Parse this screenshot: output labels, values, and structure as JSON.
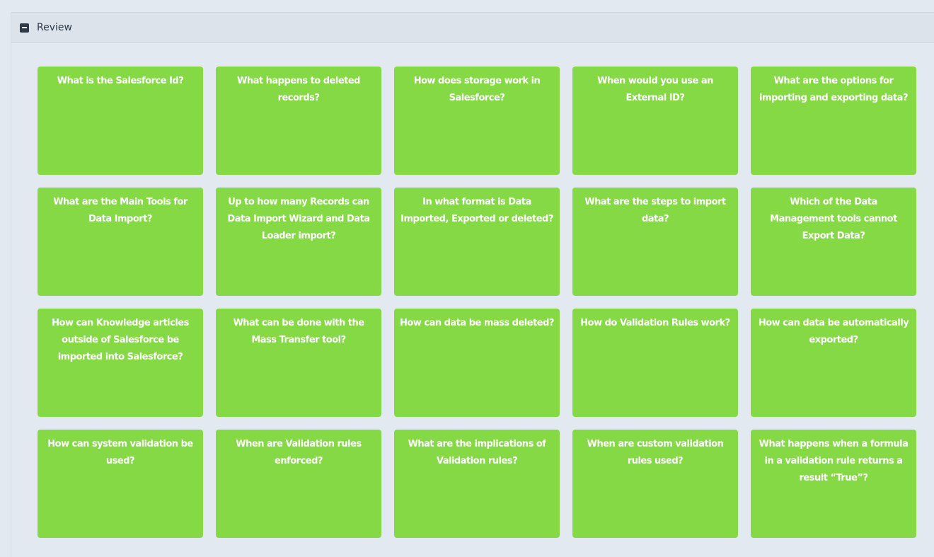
{
  "panel": {
    "title": "Review",
    "toggle_icon": "minus-square-icon"
  },
  "colors": {
    "card_background": "#84d944",
    "card_text": "#ffffff",
    "page_background": "#e3e9f1",
    "header_background": "#dde3eb"
  },
  "cards": [
    "What is the Salesforce Id?",
    "What happens to deleted records?",
    "How does storage work in Salesforce?",
    "When would you use an External ID?",
    "What are the options for importing and exporting data?",
    "What are the Main Tools for Data Import?",
    "Up to how many Records can Data Import Wizard and Data Loader import?",
    "In what format is Data Imported, Exported or deleted?",
    "What are the steps to import data?",
    "Which of the Data Management tools cannot Export Data?",
    "How can Knowledge articles outside of Salesforce be imported into Salesforce?",
    "What can be done with the Mass Transfer tool?",
    "How can data be mass deleted?",
    "How do Validation Rules work?",
    "How can data be automatically exported?",
    "How can system validation be used?",
    "When are Validation rules enforced?",
    "What are the implications of Validation rules?",
    "When are custom validation rules used?",
    "What happens when a formula in a validation rule returns a result “True”?"
  ]
}
